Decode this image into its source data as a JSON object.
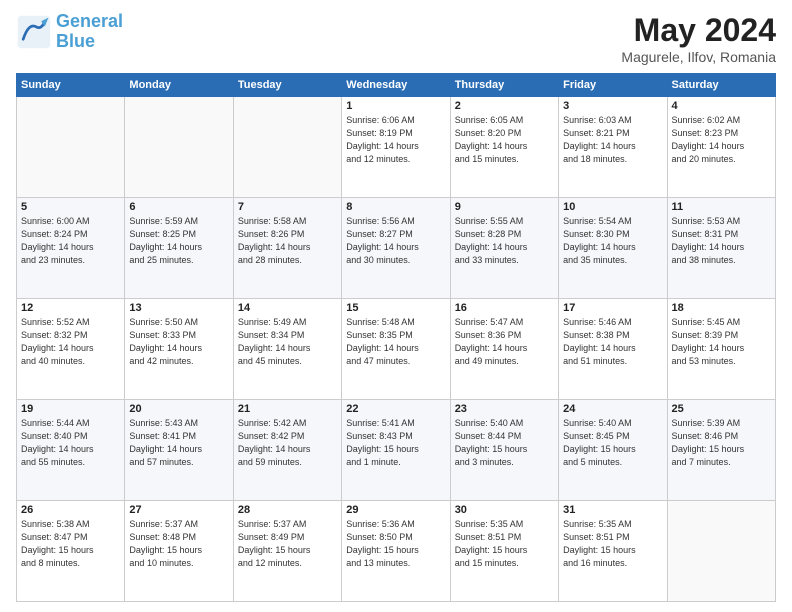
{
  "header": {
    "logo_line1": "General",
    "logo_line2": "Blue",
    "title": "May 2024",
    "subtitle": "Magurele, Ilfov, Romania"
  },
  "weekdays": [
    "Sunday",
    "Monday",
    "Tuesday",
    "Wednesday",
    "Thursday",
    "Friday",
    "Saturday"
  ],
  "weeks": [
    [
      {
        "day": "",
        "text": ""
      },
      {
        "day": "",
        "text": ""
      },
      {
        "day": "",
        "text": ""
      },
      {
        "day": "1",
        "text": "Sunrise: 6:06 AM\nSunset: 8:19 PM\nDaylight: 14 hours\nand 12 minutes."
      },
      {
        "day": "2",
        "text": "Sunrise: 6:05 AM\nSunset: 8:20 PM\nDaylight: 14 hours\nand 15 minutes."
      },
      {
        "day": "3",
        "text": "Sunrise: 6:03 AM\nSunset: 8:21 PM\nDaylight: 14 hours\nand 18 minutes."
      },
      {
        "day": "4",
        "text": "Sunrise: 6:02 AM\nSunset: 8:23 PM\nDaylight: 14 hours\nand 20 minutes."
      }
    ],
    [
      {
        "day": "5",
        "text": "Sunrise: 6:00 AM\nSunset: 8:24 PM\nDaylight: 14 hours\nand 23 minutes."
      },
      {
        "day": "6",
        "text": "Sunrise: 5:59 AM\nSunset: 8:25 PM\nDaylight: 14 hours\nand 25 minutes."
      },
      {
        "day": "7",
        "text": "Sunrise: 5:58 AM\nSunset: 8:26 PM\nDaylight: 14 hours\nand 28 minutes."
      },
      {
        "day": "8",
        "text": "Sunrise: 5:56 AM\nSunset: 8:27 PM\nDaylight: 14 hours\nand 30 minutes."
      },
      {
        "day": "9",
        "text": "Sunrise: 5:55 AM\nSunset: 8:28 PM\nDaylight: 14 hours\nand 33 minutes."
      },
      {
        "day": "10",
        "text": "Sunrise: 5:54 AM\nSunset: 8:30 PM\nDaylight: 14 hours\nand 35 minutes."
      },
      {
        "day": "11",
        "text": "Sunrise: 5:53 AM\nSunset: 8:31 PM\nDaylight: 14 hours\nand 38 minutes."
      }
    ],
    [
      {
        "day": "12",
        "text": "Sunrise: 5:52 AM\nSunset: 8:32 PM\nDaylight: 14 hours\nand 40 minutes."
      },
      {
        "day": "13",
        "text": "Sunrise: 5:50 AM\nSunset: 8:33 PM\nDaylight: 14 hours\nand 42 minutes."
      },
      {
        "day": "14",
        "text": "Sunrise: 5:49 AM\nSunset: 8:34 PM\nDaylight: 14 hours\nand 45 minutes."
      },
      {
        "day": "15",
        "text": "Sunrise: 5:48 AM\nSunset: 8:35 PM\nDaylight: 14 hours\nand 47 minutes."
      },
      {
        "day": "16",
        "text": "Sunrise: 5:47 AM\nSunset: 8:36 PM\nDaylight: 14 hours\nand 49 minutes."
      },
      {
        "day": "17",
        "text": "Sunrise: 5:46 AM\nSunset: 8:38 PM\nDaylight: 14 hours\nand 51 minutes."
      },
      {
        "day": "18",
        "text": "Sunrise: 5:45 AM\nSunset: 8:39 PM\nDaylight: 14 hours\nand 53 minutes."
      }
    ],
    [
      {
        "day": "19",
        "text": "Sunrise: 5:44 AM\nSunset: 8:40 PM\nDaylight: 14 hours\nand 55 minutes."
      },
      {
        "day": "20",
        "text": "Sunrise: 5:43 AM\nSunset: 8:41 PM\nDaylight: 14 hours\nand 57 minutes."
      },
      {
        "day": "21",
        "text": "Sunrise: 5:42 AM\nSunset: 8:42 PM\nDaylight: 14 hours\nand 59 minutes."
      },
      {
        "day": "22",
        "text": "Sunrise: 5:41 AM\nSunset: 8:43 PM\nDaylight: 15 hours\nand 1 minute."
      },
      {
        "day": "23",
        "text": "Sunrise: 5:40 AM\nSunset: 8:44 PM\nDaylight: 15 hours\nand 3 minutes."
      },
      {
        "day": "24",
        "text": "Sunrise: 5:40 AM\nSunset: 8:45 PM\nDaylight: 15 hours\nand 5 minutes."
      },
      {
        "day": "25",
        "text": "Sunrise: 5:39 AM\nSunset: 8:46 PM\nDaylight: 15 hours\nand 7 minutes."
      }
    ],
    [
      {
        "day": "26",
        "text": "Sunrise: 5:38 AM\nSunset: 8:47 PM\nDaylight: 15 hours\nand 8 minutes."
      },
      {
        "day": "27",
        "text": "Sunrise: 5:37 AM\nSunset: 8:48 PM\nDaylight: 15 hours\nand 10 minutes."
      },
      {
        "day": "28",
        "text": "Sunrise: 5:37 AM\nSunset: 8:49 PM\nDaylight: 15 hours\nand 12 minutes."
      },
      {
        "day": "29",
        "text": "Sunrise: 5:36 AM\nSunset: 8:50 PM\nDaylight: 15 hours\nand 13 minutes."
      },
      {
        "day": "30",
        "text": "Sunrise: 5:35 AM\nSunset: 8:51 PM\nDaylight: 15 hours\nand 15 minutes."
      },
      {
        "day": "31",
        "text": "Sunrise: 5:35 AM\nSunset: 8:51 PM\nDaylight: 15 hours\nand 16 minutes."
      },
      {
        "day": "",
        "text": ""
      }
    ]
  ]
}
